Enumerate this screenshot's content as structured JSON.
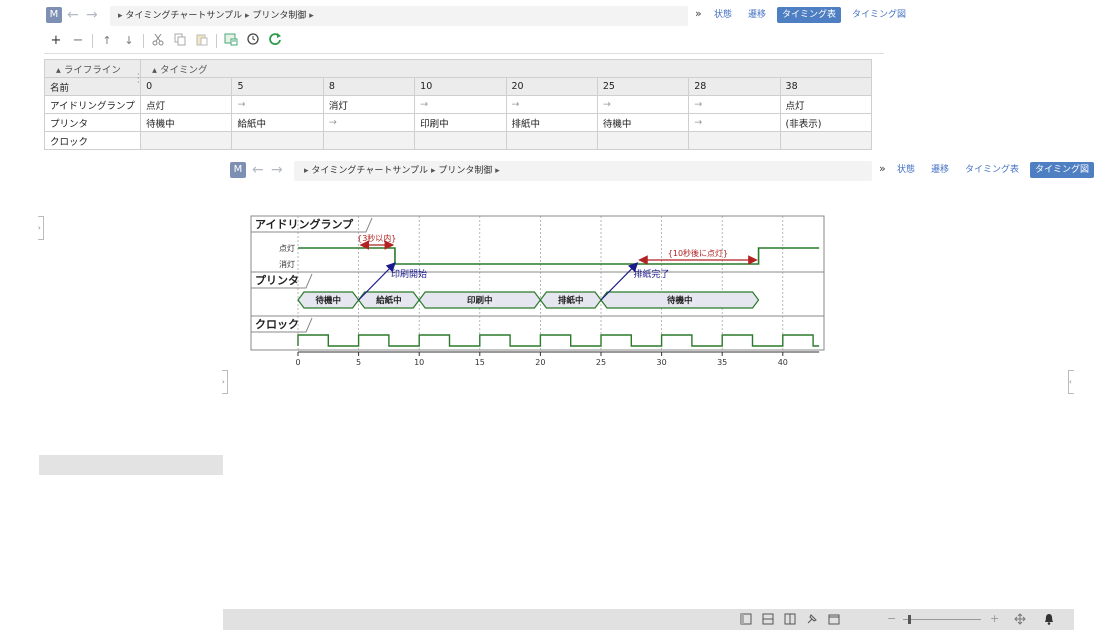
{
  "nav_top": {
    "badge": "M",
    "back_arrow": "←",
    "forward_arrow": "→",
    "breadcrumb": [
      "タイミングチャートサンプル",
      "プリンタ制御"
    ],
    "more": "»",
    "tabs": [
      "状態",
      "遷移",
      "タイミング表",
      "タイミング図"
    ],
    "active_tab": "タイミング表"
  },
  "toolbar": {
    "add": "+",
    "remove": "−",
    "up": "↑",
    "down": "↓",
    "icons": [
      "plus-icon",
      "minus-icon",
      "arrow-up-icon",
      "arrow-down-icon",
      "cut-icon",
      "copy-icon",
      "paste-icon",
      "export-image-icon",
      "history-icon",
      "refresh-icon"
    ]
  },
  "table": {
    "group_lifeline": "ライフライン",
    "group_timing": "タイミング",
    "name_header": "名前",
    "columns": [
      "0",
      "5",
      "8",
      "10",
      "20",
      "25",
      "28",
      "38"
    ],
    "rows": [
      {
        "name": "アイドリングランプ",
        "cells": [
          "点灯",
          "→",
          "消灯",
          "→",
          "→",
          "→",
          "→",
          "点灯"
        ]
      },
      {
        "name": "プリンタ",
        "cells": [
          "待機中",
          "給紙中",
          "→",
          "印刷中",
          "排紙中",
          "待機中",
          "→",
          "(非表示)"
        ]
      },
      {
        "name": "クロック",
        "cells": [
          "",
          "",
          "",
          "",
          "",
          "",
          "",
          ""
        ]
      }
    ]
  },
  "nav_bottom": {
    "badge": "M",
    "back_arrow": "←",
    "forward_arrow": "→",
    "breadcrumb": [
      "タイミングチャートサンプル",
      "プリンタ制御"
    ],
    "more": "»",
    "tabs": [
      "状態",
      "遷移",
      "タイミング表",
      "タイミング図"
    ],
    "active_tab": "タイミング図"
  },
  "diagram": {
    "lanes": {
      "lamp": {
        "title": "アイドリングランプ",
        "states": [
          "点灯",
          "消灯"
        ],
        "segments": [
          {
            "from": 0,
            "to": 8,
            "state": "点灯"
          },
          {
            "from": 8,
            "to": 38,
            "state": "消灯"
          },
          {
            "from": 38,
            "to": 43,
            "state": "点灯"
          }
        ],
        "constraints": [
          {
            "label": "{3秒以内}",
            "from": 5,
            "to": 8
          },
          {
            "label": "{10秒後に点灯}",
            "from": 28,
            "to": 38
          }
        ]
      },
      "printer": {
        "title": "プリンタ",
        "states": [
          {
            "label": "待機中",
            "from": 0,
            "to": 5
          },
          {
            "label": "給紙中",
            "from": 5,
            "to": 10
          },
          {
            "label": "印刷中",
            "from": 10,
            "to": 20
          },
          {
            "label": "排紙中",
            "from": 20,
            "to": 25
          },
          {
            "label": "待機中",
            "from": 25,
            "to": 38
          }
        ]
      },
      "clock": {
        "title": "クロック",
        "period": 5,
        "start": 0,
        "end": 43
      }
    },
    "messages": [
      {
        "label": "印刷開始",
        "from_lane": "printer",
        "from_time": 5,
        "to_lane": "lamp",
        "to_time": 8
      },
      {
        "label": "排紙完了",
        "from_lane": "printer",
        "from_time": 25,
        "to_lane": "lamp",
        "to_time": 28
      }
    ],
    "axis": {
      "min": 0,
      "max": 43,
      "ticks": [
        0,
        5,
        10,
        15,
        20,
        25,
        30,
        35,
        40
      ]
    },
    "colors": {
      "signal": "#2a7a2a",
      "constraint": "#b22222",
      "message": "#1a1a8c",
      "state_fill": "#e6e6f0"
    }
  },
  "statusbar": {
    "icons": [
      "layout-single-icon",
      "layout-split-horizontal-icon",
      "layout-split-vertical-icon",
      "pin-icon",
      "window-icon",
      "zoom-out-icon",
      "zoom-slider",
      "zoom-in-icon",
      "fit-icon",
      "notification-bell-icon"
    ],
    "zoom_minus": "−",
    "zoom_plus": "+"
  }
}
